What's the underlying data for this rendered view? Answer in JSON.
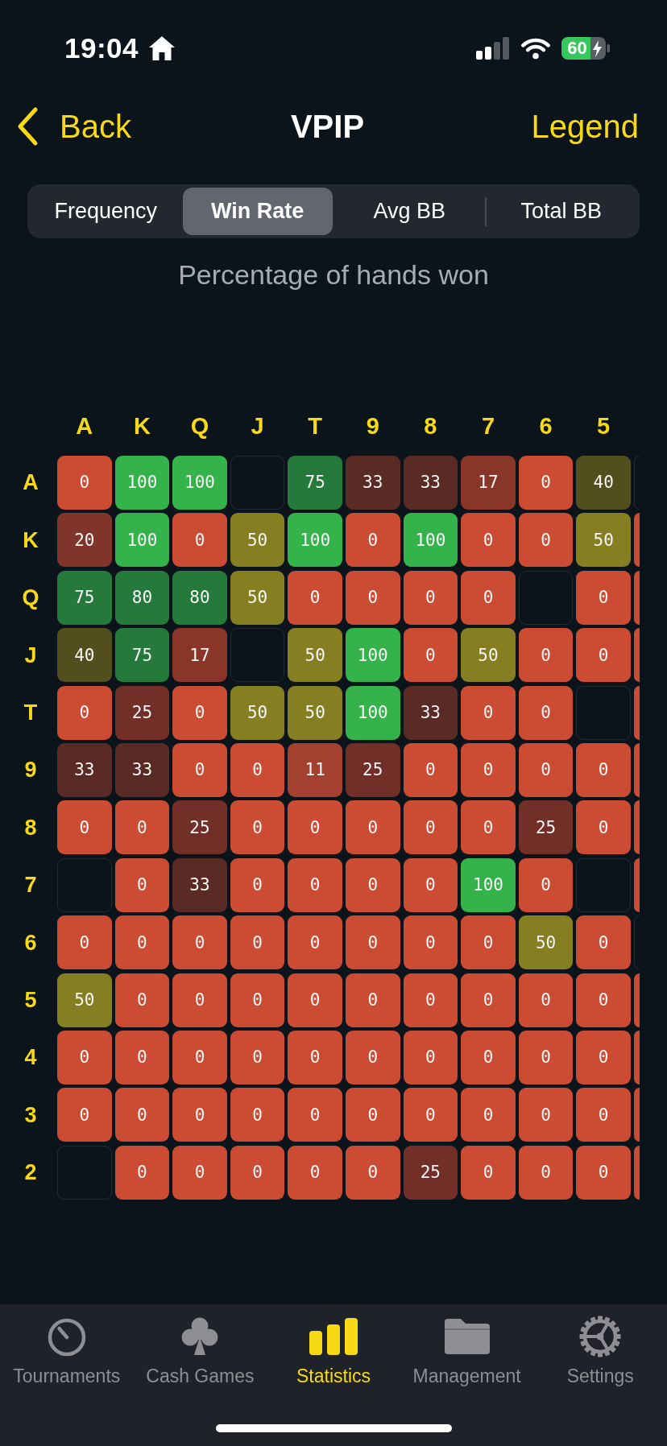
{
  "status_bar": {
    "time": "19:04",
    "battery": "60"
  },
  "nav_bar": {
    "back": "Back",
    "title": "VPIP",
    "action": "Legend"
  },
  "segments": [
    {
      "label": "Frequency",
      "selected": false
    },
    {
      "label": "Win Rate",
      "selected": true
    },
    {
      "label": "Avg BB",
      "selected": false
    },
    {
      "label": "Total BB",
      "selected": false
    }
  ],
  "subtitle": "Percentage of hands won",
  "grid": {
    "columns": [
      "A",
      "K",
      "Q",
      "J",
      "T",
      "9",
      "8",
      "7",
      "6",
      "5"
    ],
    "rows": [
      {
        "label": "A",
        "cells": [
          {
            "kind": "value",
            "text": "0",
            "color": "#cc4c33"
          },
          {
            "kind": "value",
            "text": "100",
            "color": "#35b34b"
          },
          {
            "kind": "value",
            "text": "100",
            "color": "#35b34b"
          },
          {
            "kind": "empty"
          },
          {
            "kind": "value",
            "text": "75",
            "color": "#25793b"
          },
          {
            "kind": "value",
            "text": "33",
            "color": "#5a2b25"
          },
          {
            "kind": "value",
            "text": "33",
            "color": "#5a2b25"
          },
          {
            "kind": "value",
            "text": "17",
            "color": "#893629"
          },
          {
            "kind": "value",
            "text": "0",
            "color": "#cc4c33"
          },
          {
            "kind": "value",
            "text": "40",
            "color": "#524e1e"
          }
        ],
        "edge_cell": {
          "kind": "empty"
        }
      },
      {
        "label": "K",
        "cells": [
          {
            "kind": "value",
            "text": "20",
            "color": "#80342a"
          },
          {
            "kind": "value",
            "text": "100",
            "color": "#35b34b"
          },
          {
            "kind": "value",
            "text": "0",
            "color": "#cc4c33"
          },
          {
            "kind": "value",
            "text": "50",
            "color": "#857f21"
          },
          {
            "kind": "value",
            "text": "100",
            "color": "#35b34b"
          },
          {
            "kind": "value",
            "text": "0",
            "color": "#cc4c33"
          },
          {
            "kind": "value",
            "text": "100",
            "color": "#35b34b"
          },
          {
            "kind": "value",
            "text": "0",
            "color": "#cc4c33"
          },
          {
            "kind": "value",
            "text": "0",
            "color": "#cc4c33"
          },
          {
            "kind": "value",
            "text": "50",
            "color": "#857f21"
          }
        ],
        "edge_cell": {
          "kind": "filled",
          "color": "#cc4c33"
        }
      },
      {
        "label": "Q",
        "cells": [
          {
            "kind": "value",
            "text": "75",
            "color": "#25793b"
          },
          {
            "kind": "value",
            "text": "80",
            "color": "#25793b"
          },
          {
            "kind": "value",
            "text": "80",
            "color": "#25793b"
          },
          {
            "kind": "value",
            "text": "50",
            "color": "#857f21"
          },
          {
            "kind": "value",
            "text": "0",
            "color": "#cc4c33"
          },
          {
            "kind": "value",
            "text": "0",
            "color": "#cc4c33"
          },
          {
            "kind": "value",
            "text": "0",
            "color": "#cc4c33"
          },
          {
            "kind": "value",
            "text": "0",
            "color": "#cc4c33"
          },
          {
            "kind": "empty"
          },
          {
            "kind": "value",
            "text": "0",
            "color": "#cc4c33"
          }
        ],
        "edge_cell": {
          "kind": "filled",
          "color": "#cc4c33"
        }
      },
      {
        "label": "J",
        "cells": [
          {
            "kind": "value",
            "text": "40",
            "color": "#524e1e"
          },
          {
            "kind": "value",
            "text": "75",
            "color": "#25793b"
          },
          {
            "kind": "value",
            "text": "17",
            "color": "#893629"
          },
          {
            "kind": "empty"
          },
          {
            "kind": "value",
            "text": "50",
            "color": "#857f21"
          },
          {
            "kind": "value",
            "text": "100",
            "color": "#35b34b"
          },
          {
            "kind": "value",
            "text": "0",
            "color": "#cc4c33"
          },
          {
            "kind": "value",
            "text": "50",
            "color": "#857f21"
          },
          {
            "kind": "value",
            "text": "0",
            "color": "#cc4c33"
          },
          {
            "kind": "value",
            "text": "0",
            "color": "#cc4c33"
          }
        ],
        "edge_cell": {
          "kind": "filled",
          "color": "#cc4c33"
        }
      },
      {
        "label": "T",
        "cells": [
          {
            "kind": "value",
            "text": "0",
            "color": "#cc4c33"
          },
          {
            "kind": "value",
            "text": "25",
            "color": "#712f28"
          },
          {
            "kind": "value",
            "text": "0",
            "color": "#cc4c33"
          },
          {
            "kind": "value",
            "text": "50",
            "color": "#857f21"
          },
          {
            "kind": "value",
            "text": "50",
            "color": "#857f21"
          },
          {
            "kind": "value",
            "text": "100",
            "color": "#35b34b"
          },
          {
            "kind": "value",
            "text": "33",
            "color": "#5a2b25"
          },
          {
            "kind": "value",
            "text": "0",
            "color": "#cc4c33"
          },
          {
            "kind": "value",
            "text": "0",
            "color": "#cc4c33"
          },
          {
            "kind": "empty"
          }
        ],
        "edge_cell": {
          "kind": "filled",
          "color": "#cc4c33"
        }
      },
      {
        "label": "9",
        "cells": [
          {
            "kind": "value",
            "text": "33",
            "color": "#5a2b25"
          },
          {
            "kind": "value",
            "text": "33",
            "color": "#5a2b25"
          },
          {
            "kind": "value",
            "text": "0",
            "color": "#cc4c33"
          },
          {
            "kind": "value",
            "text": "0",
            "color": "#cc4c33"
          },
          {
            "kind": "value",
            "text": "11",
            "color": "#a3402f"
          },
          {
            "kind": "value",
            "text": "25",
            "color": "#712f28"
          },
          {
            "kind": "value",
            "text": "0",
            "color": "#cc4c33"
          },
          {
            "kind": "value",
            "text": "0",
            "color": "#cc4c33"
          },
          {
            "kind": "value",
            "text": "0",
            "color": "#cc4c33"
          },
          {
            "kind": "value",
            "text": "0",
            "color": "#cc4c33"
          }
        ],
        "edge_cell": {
          "kind": "filled",
          "color": "#cc4c33"
        }
      },
      {
        "label": "8",
        "cells": [
          {
            "kind": "value",
            "text": "0",
            "color": "#cc4c33"
          },
          {
            "kind": "value",
            "text": "0",
            "color": "#cc4c33"
          },
          {
            "kind": "value",
            "text": "25",
            "color": "#712f28"
          },
          {
            "kind": "value",
            "text": "0",
            "color": "#cc4c33"
          },
          {
            "kind": "value",
            "text": "0",
            "color": "#cc4c33"
          },
          {
            "kind": "value",
            "text": "0",
            "color": "#cc4c33"
          },
          {
            "kind": "value",
            "text": "0",
            "color": "#cc4c33"
          },
          {
            "kind": "value",
            "text": "0",
            "color": "#cc4c33"
          },
          {
            "kind": "value",
            "text": "25",
            "color": "#712f28"
          },
          {
            "kind": "value",
            "text": "0",
            "color": "#cc4c33"
          }
        ],
        "edge_cell": {
          "kind": "filled",
          "color": "#cc4c33"
        }
      },
      {
        "label": "7",
        "cells": [
          {
            "kind": "empty"
          },
          {
            "kind": "value",
            "text": "0",
            "color": "#cc4c33"
          },
          {
            "kind": "value",
            "text": "33",
            "color": "#5a2b25"
          },
          {
            "kind": "value",
            "text": "0",
            "color": "#cc4c33"
          },
          {
            "kind": "value",
            "text": "0",
            "color": "#cc4c33"
          },
          {
            "kind": "value",
            "text": "0",
            "color": "#cc4c33"
          },
          {
            "kind": "value",
            "text": "0",
            "color": "#cc4c33"
          },
          {
            "kind": "value",
            "text": "100",
            "color": "#35b34b"
          },
          {
            "kind": "value",
            "text": "0",
            "color": "#cc4c33"
          },
          {
            "kind": "empty"
          }
        ],
        "edge_cell": {
          "kind": "filled",
          "color": "#cc4c33"
        }
      },
      {
        "label": "6",
        "cells": [
          {
            "kind": "value",
            "text": "0",
            "color": "#cc4c33"
          },
          {
            "kind": "value",
            "text": "0",
            "color": "#cc4c33"
          },
          {
            "kind": "value",
            "text": "0",
            "color": "#cc4c33"
          },
          {
            "kind": "value",
            "text": "0",
            "color": "#cc4c33"
          },
          {
            "kind": "value",
            "text": "0",
            "color": "#cc4c33"
          },
          {
            "kind": "value",
            "text": "0",
            "color": "#cc4c33"
          },
          {
            "kind": "value",
            "text": "0",
            "color": "#cc4c33"
          },
          {
            "kind": "value",
            "text": "0",
            "color": "#cc4c33"
          },
          {
            "kind": "value",
            "text": "50",
            "color": "#857f21"
          },
          {
            "kind": "value",
            "text": "0",
            "color": "#cc4c33"
          }
        ],
        "edge_cell": {
          "kind": "empty"
        }
      },
      {
        "label": "5",
        "cells": [
          {
            "kind": "value",
            "text": "50",
            "color": "#857f21"
          },
          {
            "kind": "value",
            "text": "0",
            "color": "#cc4c33"
          },
          {
            "kind": "value",
            "text": "0",
            "color": "#cc4c33"
          },
          {
            "kind": "value",
            "text": "0",
            "color": "#cc4c33"
          },
          {
            "kind": "value",
            "text": "0",
            "color": "#cc4c33"
          },
          {
            "kind": "value",
            "text": "0",
            "color": "#cc4c33"
          },
          {
            "kind": "value",
            "text": "0",
            "color": "#cc4c33"
          },
          {
            "kind": "value",
            "text": "0",
            "color": "#cc4c33"
          },
          {
            "kind": "value",
            "text": "0",
            "color": "#cc4c33"
          },
          {
            "kind": "value",
            "text": "0",
            "color": "#cc4c33"
          }
        ],
        "edge_cell": {
          "kind": "filled",
          "color": "#cc4c33"
        }
      },
      {
        "label": "4",
        "cells": [
          {
            "kind": "value",
            "text": "0",
            "color": "#cc4c33"
          },
          {
            "kind": "value",
            "text": "0",
            "color": "#cc4c33"
          },
          {
            "kind": "value",
            "text": "0",
            "color": "#cc4c33"
          },
          {
            "kind": "value",
            "text": "0",
            "color": "#cc4c33"
          },
          {
            "kind": "value",
            "text": "0",
            "color": "#cc4c33"
          },
          {
            "kind": "value",
            "text": "0",
            "color": "#cc4c33"
          },
          {
            "kind": "value",
            "text": "0",
            "color": "#cc4c33"
          },
          {
            "kind": "value",
            "text": "0",
            "color": "#cc4c33"
          },
          {
            "kind": "value",
            "text": "0",
            "color": "#cc4c33"
          },
          {
            "kind": "value",
            "text": "0",
            "color": "#cc4c33"
          }
        ],
        "edge_cell": {
          "kind": "filled",
          "color": "#cc4c33"
        }
      },
      {
        "label": "3",
        "cells": [
          {
            "kind": "value",
            "text": "0",
            "color": "#cc4c33"
          },
          {
            "kind": "value",
            "text": "0",
            "color": "#cc4c33"
          },
          {
            "kind": "value",
            "text": "0",
            "color": "#cc4c33"
          },
          {
            "kind": "value",
            "text": "0",
            "color": "#cc4c33"
          },
          {
            "kind": "value",
            "text": "0",
            "color": "#cc4c33"
          },
          {
            "kind": "value",
            "text": "0",
            "color": "#cc4c33"
          },
          {
            "kind": "value",
            "text": "0",
            "color": "#cc4c33"
          },
          {
            "kind": "value",
            "text": "0",
            "color": "#cc4c33"
          },
          {
            "kind": "value",
            "text": "0",
            "color": "#cc4c33"
          },
          {
            "kind": "value",
            "text": "0",
            "color": "#cc4c33"
          }
        ],
        "edge_cell": {
          "kind": "filled",
          "color": "#cc4c33"
        }
      },
      {
        "label": "2",
        "cells": [
          {
            "kind": "empty"
          },
          {
            "kind": "value",
            "text": "0",
            "color": "#cc4c33"
          },
          {
            "kind": "value",
            "text": "0",
            "color": "#cc4c33"
          },
          {
            "kind": "value",
            "text": "0",
            "color": "#cc4c33"
          },
          {
            "kind": "value",
            "text": "0",
            "color": "#cc4c33"
          },
          {
            "kind": "value",
            "text": "0",
            "color": "#cc4c33"
          },
          {
            "kind": "value",
            "text": "25",
            "color": "#712f28"
          },
          {
            "kind": "value",
            "text": "0",
            "color": "#cc4c33"
          },
          {
            "kind": "value",
            "text": "0",
            "color": "#cc4c33"
          },
          {
            "kind": "value",
            "text": "0",
            "color": "#cc4c33"
          }
        ],
        "edge_cell": {
          "kind": "filled",
          "color": "#cc4c33"
        }
      }
    ]
  },
  "tab_bar": [
    {
      "label": "Tournaments",
      "selected": false
    },
    {
      "label": "Cash Games",
      "selected": false
    },
    {
      "label": "Statistics",
      "selected": true
    },
    {
      "label": "Management",
      "selected": false
    },
    {
      "label": "Settings",
      "selected": false
    }
  ]
}
